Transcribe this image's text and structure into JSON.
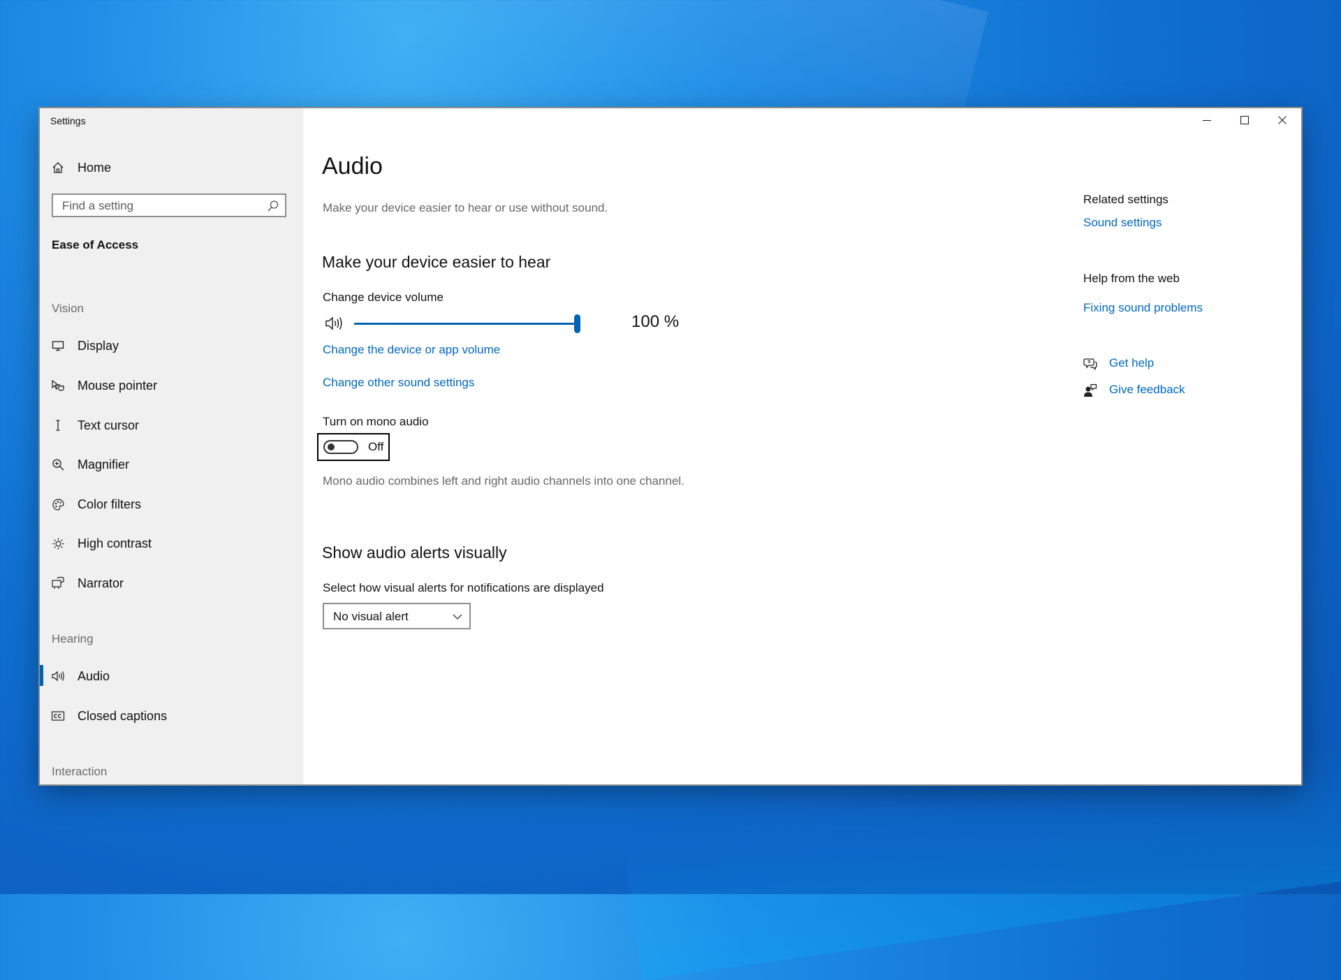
{
  "window": {
    "title": "Settings",
    "controls": {
      "minimize": "minimize",
      "maximize": "maximize",
      "close": "close"
    }
  },
  "sidebar": {
    "home_label": "Home",
    "search": {
      "placeholder": "Find a setting"
    },
    "category": "Ease of Access",
    "sections": {
      "vision": "Vision",
      "hearing": "Hearing",
      "interaction": "Interaction"
    },
    "vision_items": [
      {
        "label": "Display",
        "icon": "display-icon"
      },
      {
        "label": "Mouse pointer",
        "icon": "mouse-pointer-icon"
      },
      {
        "label": "Text cursor",
        "icon": "text-cursor-icon"
      },
      {
        "label": "Magnifier",
        "icon": "magnifier-icon"
      },
      {
        "label": "Color filters",
        "icon": "color-filters-icon"
      },
      {
        "label": "High contrast",
        "icon": "high-contrast-icon"
      },
      {
        "label": "Narrator",
        "icon": "narrator-icon"
      }
    ],
    "hearing_items": [
      {
        "label": "Audio",
        "icon": "speaker-icon",
        "active": true
      },
      {
        "label": "Closed captions",
        "icon": "closed-captions-icon"
      }
    ],
    "accent": "#0063b1"
  },
  "main": {
    "title": "Audio",
    "subtitle": "Make your device easier to hear or use without sound.",
    "hear_heading": "Make your device easier to hear",
    "volume_label": "Change device volume",
    "volume_value": 100,
    "volume_text": "100 %",
    "link_app_volume": "Change the device or app volume",
    "link_other_sound": "Change other sound settings",
    "mono_label": "Turn on mono audio",
    "mono_state": "Off",
    "mono_desc": "Mono audio combines left and right audio channels into one channel.",
    "alerts_heading": "Show audio alerts visually",
    "alerts_label": "Select how visual alerts for notifications are displayed",
    "alerts_value": "No visual alert",
    "link_color": "#0067c0"
  },
  "related": {
    "heading": "Related settings",
    "sound_settings": "Sound settings",
    "web_heading": "Help from the web",
    "fixing_sound": "Fixing sound problems",
    "get_help": "Get help",
    "give_feedback": "Give feedback"
  }
}
